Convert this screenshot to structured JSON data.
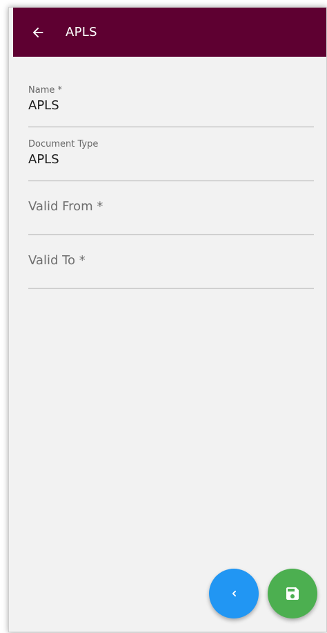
{
  "app_bar": {
    "title": "APLS",
    "back_icon": "arrow-left-icon",
    "background_color": "#5e0031"
  },
  "form": {
    "fields": [
      {
        "label": "Name *",
        "value": "APLS"
      },
      {
        "label": "Document Type",
        "value": "APLS"
      },
      {
        "label": "Valid From *",
        "value": ""
      },
      {
        "label": "Valid To *",
        "value": ""
      }
    ]
  },
  "actions": {
    "previous_icon": "chevron-left-icon",
    "previous_color": "#2196f3",
    "save_icon": "save-icon",
    "save_color": "#4caf50"
  }
}
